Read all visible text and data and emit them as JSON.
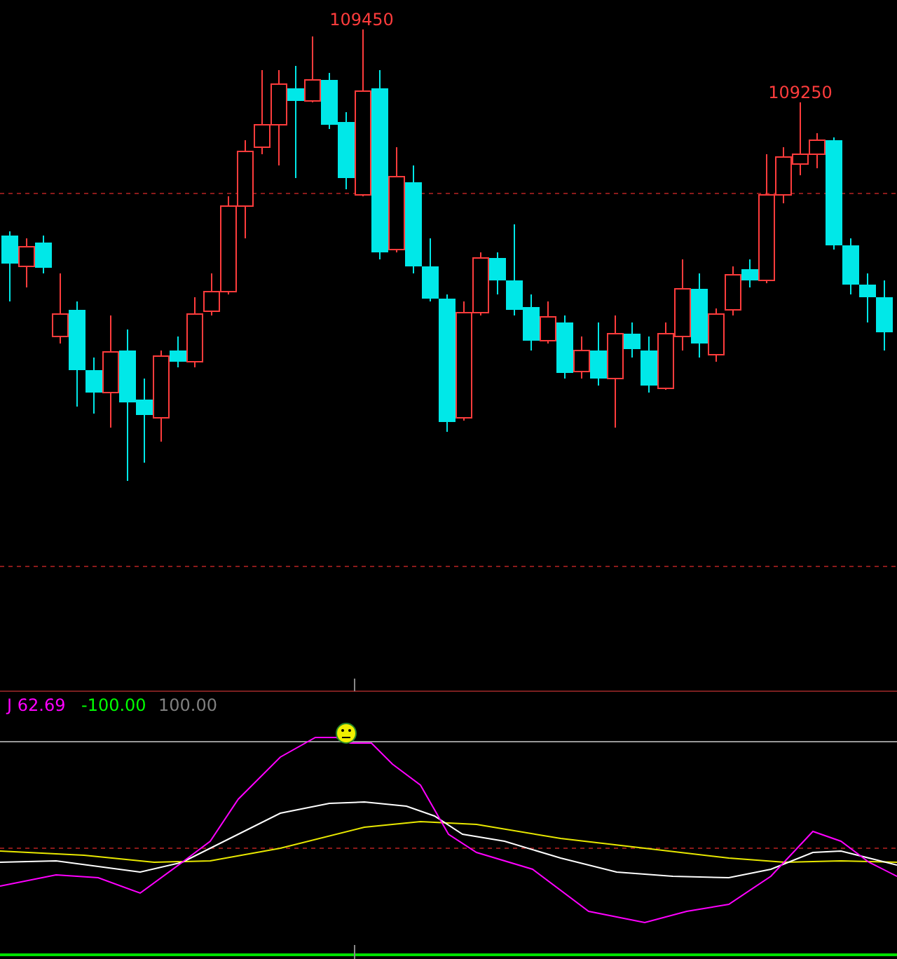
{
  "price_chart": {
    "high_labels": [
      {
        "text": "109450"
      },
      {
        "text": "109250"
      }
    ]
  },
  "indicator": {
    "readings": [
      {
        "text": "J 62.69",
        "color": "#ff00ff"
      },
      {
        "text": "-100.00",
        "color": "#00ff00"
      },
      {
        "text": "100.00",
        "color": "#808080"
      }
    ]
  }
}
